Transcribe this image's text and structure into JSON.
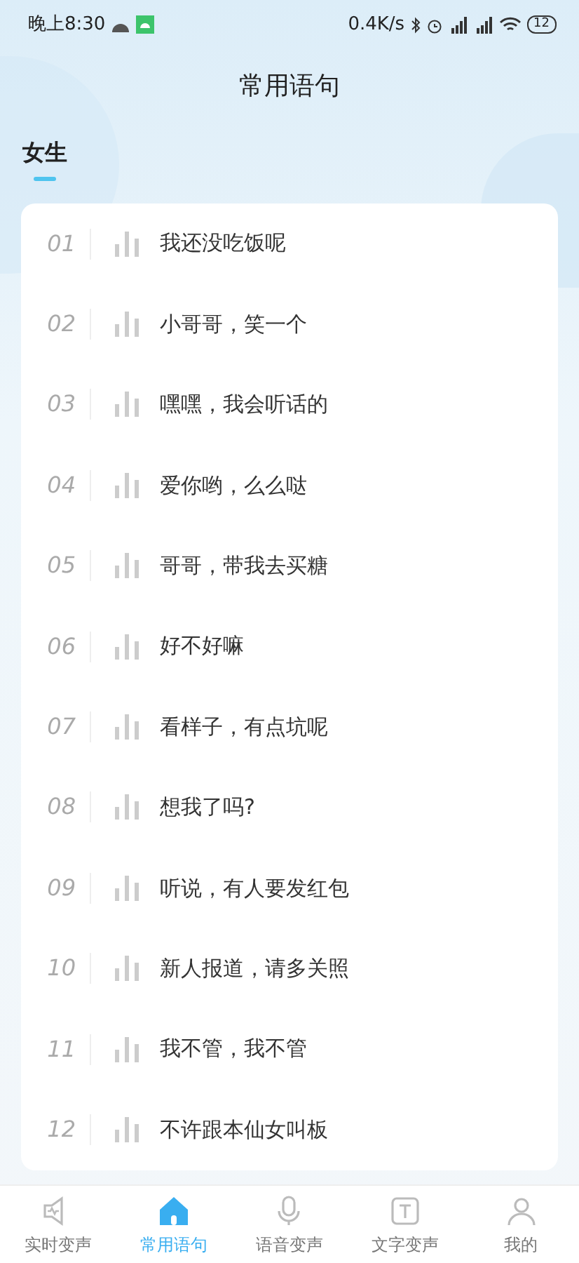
{
  "status_bar": {
    "time": "晚上8:30",
    "speed": "0.4K/s",
    "battery": "12"
  },
  "title": "常用语句",
  "category_tabs": [
    {
      "label": "女生",
      "selected": true
    }
  ],
  "phrases": [
    {
      "number": "01",
      "text": "我还没吃饭呢"
    },
    {
      "number": "02",
      "text": "小哥哥，笑一个"
    },
    {
      "number": "03",
      "text": "嘿嘿，我会听话的"
    },
    {
      "number": "04",
      "text": "爱你哟，么么哒"
    },
    {
      "number": "05",
      "text": "哥哥，带我去买糖"
    },
    {
      "number": "06",
      "text": "好不好嘛"
    },
    {
      "number": "07",
      "text": "看样子，有点坑呢"
    },
    {
      "number": "08",
      "text": "想我了吗?"
    },
    {
      "number": "09",
      "text": "听说，有人要发红包"
    },
    {
      "number": "10",
      "text": "新人报道，请多关照"
    },
    {
      "number": "11",
      "text": "我不管，我不管"
    },
    {
      "number": "12",
      "text": "不许跟本仙女叫板"
    }
  ],
  "bottom_nav": [
    {
      "label": "实时变声",
      "kind": "speaker",
      "selected": false
    },
    {
      "label": "常用语句",
      "kind": "home",
      "selected": true
    },
    {
      "label": "语音变声",
      "kind": "mic",
      "selected": false
    },
    {
      "label": "文字变声",
      "kind": "text",
      "selected": false
    },
    {
      "label": "我的",
      "kind": "person",
      "selected": false
    }
  ]
}
